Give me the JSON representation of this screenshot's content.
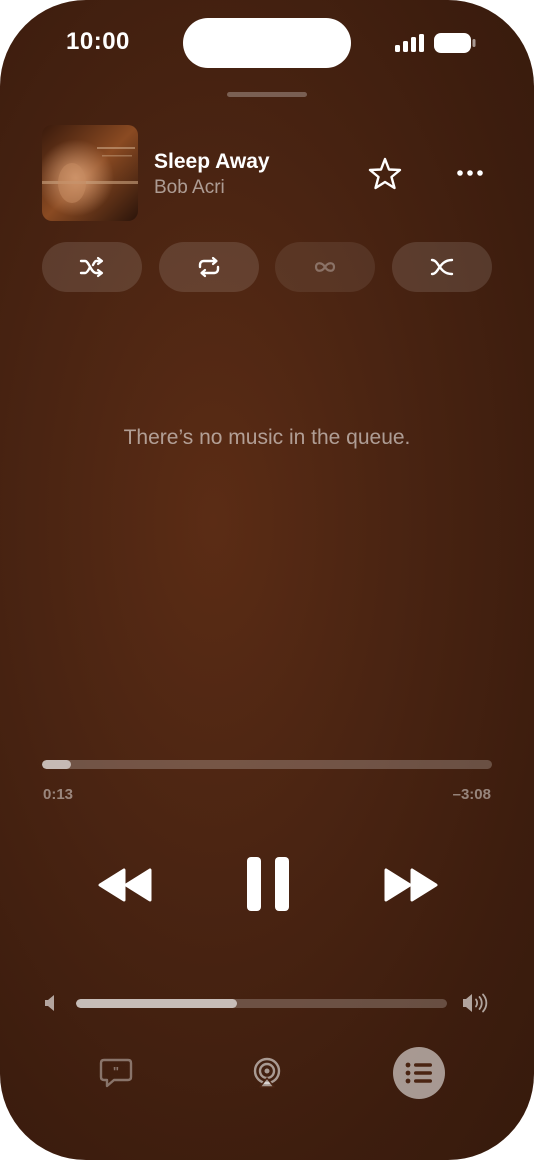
{
  "status_bar": {
    "time": "10:00",
    "icons": [
      "cellular-signal-icon",
      "battery-icon"
    ]
  },
  "now_playing": {
    "title": "Sleep Away",
    "artist": "Bob Acri",
    "artwork": "album-artwork",
    "actions": [
      "star-icon",
      "more-icon"
    ]
  },
  "playback_modes": [
    {
      "name": "shuffle",
      "icon": "shuffle-icon",
      "active": true
    },
    {
      "name": "repeat",
      "icon": "repeat-icon",
      "active": true
    },
    {
      "name": "infinity",
      "icon": "infinity-icon",
      "active": false
    },
    {
      "name": "crossfade",
      "icon": "crossfade-icon",
      "active": true
    }
  ],
  "queue": {
    "empty_message": "There’s no music in the queue."
  },
  "progress": {
    "elapsed": "0:13",
    "remaining": "–3:08",
    "fraction": 0.065
  },
  "transport": [
    "rewind-icon",
    "pause-icon",
    "fast-forward-icon"
  ],
  "volume": {
    "fraction": 0.435
  },
  "bottom_bar": [
    "lyrics-icon",
    "airplay-icon",
    "queue-list-icon"
  ],
  "colors": {
    "background": "#4a2412",
    "accent_text": "#ffffff"
  }
}
